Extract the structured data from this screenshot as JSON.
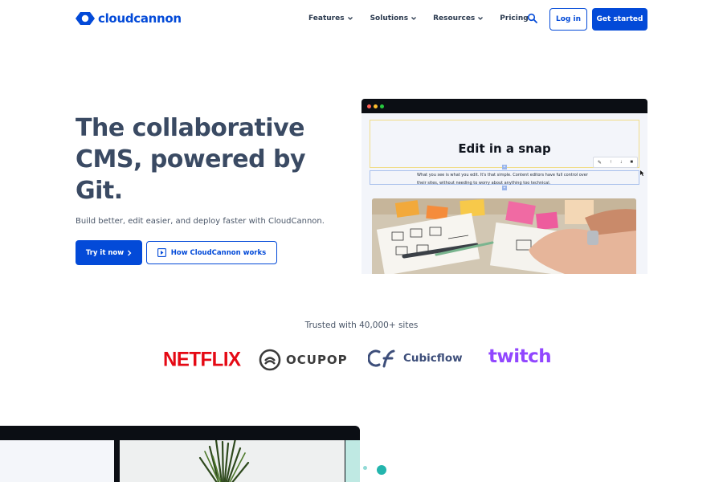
{
  "brand": {
    "name": "cloudcannon",
    "color": "#034ad8"
  },
  "nav": {
    "items": [
      {
        "label": "Features",
        "has_dropdown": true
      },
      {
        "label": "Solutions",
        "has_dropdown": true
      },
      {
        "label": "Resources",
        "has_dropdown": true
      },
      {
        "label": "Pricing",
        "has_dropdown": false
      }
    ],
    "search_icon": "search-icon",
    "login_label": "Log in",
    "started_label": "Get started"
  },
  "hero": {
    "title": "The collaborative CMS, powered by Git.",
    "subtitle": "Build better, edit easier, and deploy faster with CloudCannon.",
    "try_label": "Try it now",
    "how_label": "How CloudCannon works"
  },
  "mock": {
    "heading": "Edit in a snap",
    "body": "What you see is what you edit. It's that simple. Content editors have full control over their sites, without needing to worry about anything too technical."
  },
  "trusted": {
    "label": "Trusted with 40,000+ sites",
    "logos": [
      "NETFLIX",
      "OCUPOP",
      "Cubicflow",
      "twitch"
    ]
  },
  "colors": {
    "primary": "#034ad8",
    "heading": "#3a4a63",
    "netflix": "#e50914",
    "twitch": "#9146ff",
    "teal": "#23b5ad"
  }
}
